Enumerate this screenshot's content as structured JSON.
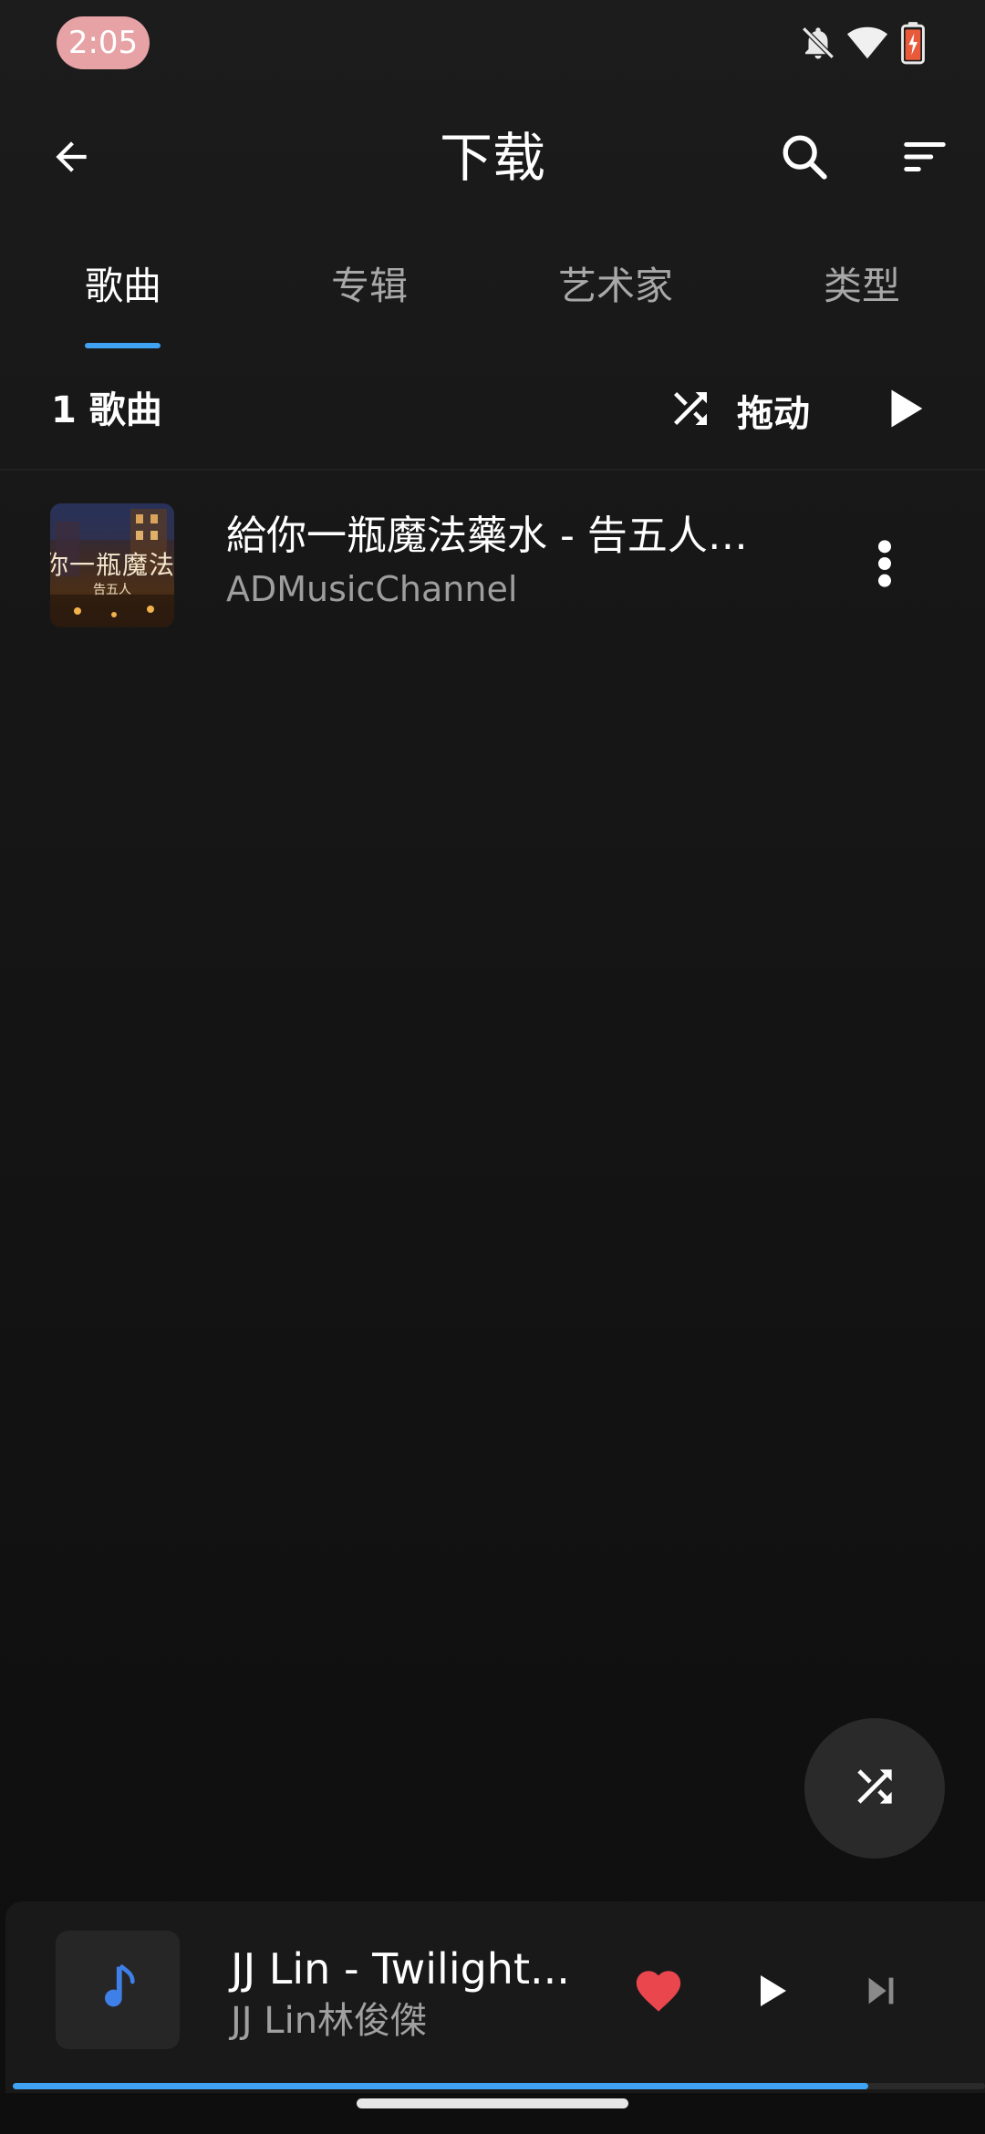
{
  "status_bar": {
    "time": "2:05",
    "icons": [
      "notifications-off-icon",
      "wifi-icon",
      "battery-charging-icon"
    ]
  },
  "app_bar": {
    "title": "下载",
    "icons": [
      "back-arrow-icon",
      "search-icon",
      "sort-icon"
    ]
  },
  "tabs": [
    {
      "label": "歌曲",
      "active": true
    },
    {
      "label": "专辑",
      "active": false
    },
    {
      "label": "艺术家",
      "active": false
    },
    {
      "label": "类型",
      "active": false
    }
  ],
  "toolbar": {
    "song_count": "1 歌曲",
    "shuffle_label": "拖动",
    "icons": [
      "shuffle-icon",
      "play-icon"
    ]
  },
  "songs": [
    {
      "title": "給你一瓶魔法藥水 - 告五人…",
      "artist": "ADMusicChannel",
      "art_text": "你一瓶魔法藥",
      "art_subtext": "告五人"
    }
  ],
  "fab": {
    "icon": "shuffle-icon"
  },
  "mini_player": {
    "title": "JJ Lin - Twilight...",
    "artist": "JJ Lin林俊傑",
    "liked": true,
    "progress": 0.88,
    "icons": [
      "music-note-icon",
      "heart-icon",
      "play-icon",
      "skip-next-icon"
    ]
  },
  "colors": {
    "accent": "#3fa2f2",
    "heart": "#e9464e",
    "clock_pill": "#e6a2a4",
    "background": "#121212"
  }
}
